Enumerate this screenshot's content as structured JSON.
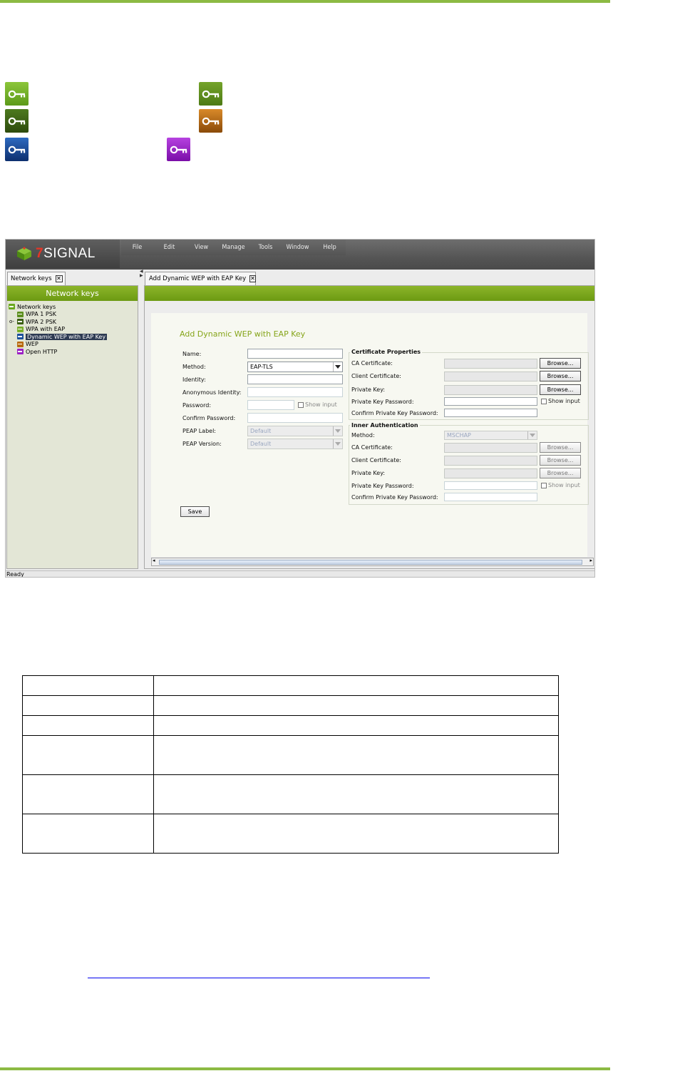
{
  "colors": {
    "accent_line": "#8cba43",
    "key_light_green": "#7ab02a",
    "key_green": "#5c8f1e",
    "key_dark_green": "#3a5e12",
    "key_orange": "#b86a10",
    "key_blue": "#1b4f9b",
    "key_purple": "#9b1fc4"
  },
  "key_icons": [
    "key-light-green-icon",
    "key-green-icon",
    "key-dark-green-icon",
    "key-orange-icon",
    "key-blue-icon",
    "key-purple-icon"
  ],
  "app": {
    "logo_prefix": "7",
    "logo_text": "SIGNAL",
    "menu": [
      "File",
      "Edit",
      "View",
      "Manage",
      "Tools",
      "Window",
      "Help"
    ],
    "left_tab": "Network keys",
    "left_panel_title": "Network keys",
    "tree": {
      "root": "Network keys",
      "items": [
        "WPA 1 PSK",
        "WPA 2 PSK",
        "WPA with EAP",
        "Dynamic WEP with EAP Key",
        "WEP",
        "Open HTTP"
      ],
      "selected": "Dynamic WEP with EAP Key"
    },
    "right_tab": "Add Dynamic WEP with EAP Key",
    "form": {
      "title": "Add Dynamic WEP with EAP Key",
      "name_label": "Name:",
      "method_label": "Method:",
      "method_value": "EAP-TLS",
      "identity_label": "Identity:",
      "anon_identity_label": "Anonymous Identity:",
      "password_label": "Password:",
      "show_input": "Show input",
      "confirm_password_label": "Confirm Password:",
      "peap_label_label": "PEAP Label:",
      "peap_label_value": "Default",
      "peap_version_label": "PEAP Version:",
      "peap_version_value": "Default",
      "save": "Save",
      "cert_group": "Certificate Properties",
      "ca_cert": "CA Certificate:",
      "client_cert": "Client Certificate:",
      "private_key": "Private Key:",
      "private_key_password": "Private Key Password:",
      "confirm_private_key_password": "Confirm Private Key Password:",
      "browse": "Browse...",
      "inner_group": "Inner Authentication",
      "inner_method_label": "Method:",
      "inner_method_value": "MSCHAP"
    },
    "status": "Ready"
  }
}
